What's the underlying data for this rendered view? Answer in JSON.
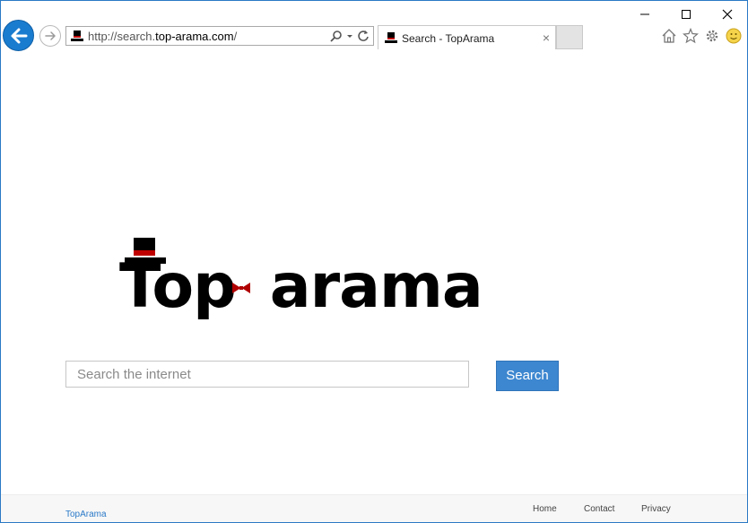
{
  "browser": {
    "address_url_prefix": "http://search.",
    "address_url_domain": "top-arama.com",
    "address_url_suffix": "/",
    "tab_title": "Search - TopArama",
    "tab_close": "×",
    "icons": [
      "back-arrow-icon",
      "forward-arrow-icon",
      "search-icon",
      "dropdown-icon",
      "refresh-icon",
      "home-icon",
      "star-icon",
      "gear-icon",
      "smiley-icon",
      "minimize-icon",
      "maximize-icon",
      "close-icon"
    ]
  },
  "logo": {
    "text_left": "Top",
    "text_right": "arama",
    "colors": {
      "hat": "#000000",
      "hat_band": "#c00000",
      "bowtie": "#b00000"
    }
  },
  "search": {
    "placeholder": "Search the internet",
    "button_label": "Search"
  },
  "footer": {
    "brand": "TopArama",
    "links": [
      "Home",
      "Contact",
      "Privacy"
    ]
  },
  "colors": {
    "accent": "#3d87d0",
    "link": "#2a79c8",
    "back_button": "#1a7ccf"
  }
}
